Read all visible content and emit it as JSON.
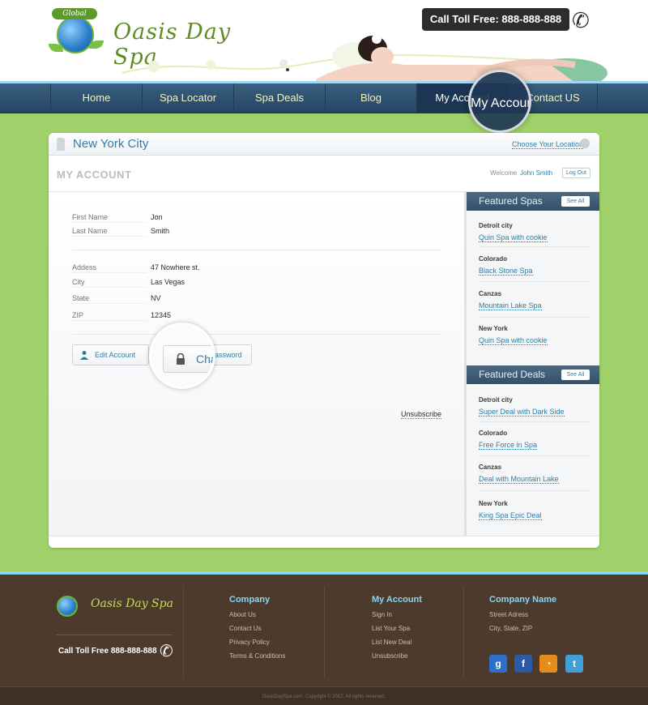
{
  "brand": {
    "name": "Oasis Day Spa",
    "badge": "Global"
  },
  "header": {
    "toll_label": "Call Toll Free: 888-888-888"
  },
  "nav": {
    "items": [
      {
        "label": "Home"
      },
      {
        "label": "Spa Locator"
      },
      {
        "label": "Spa Deals"
      },
      {
        "label": "Blog"
      },
      {
        "label": "My Account"
      },
      {
        "label": "Contact US"
      }
    ],
    "magnifier_text": "My Account"
  },
  "city_bar": {
    "city": "New York City",
    "choose": "Choose Your Location"
  },
  "account": {
    "title": "MY ACCOUNT",
    "welcome": "Welcome",
    "user": "John Smith",
    "logout": "Log Out",
    "fields": {
      "first_name": {
        "label": "First Name",
        "value": "Jon"
      },
      "last_name": {
        "label": "Last Name",
        "value": "Smith"
      },
      "address": {
        "label": "Addess",
        "value": "47 Nowhere st."
      },
      "city": {
        "label": "City",
        "value": "Las Vegas"
      },
      "state": {
        "label": "State",
        "value": "NV"
      },
      "zip": {
        "label": "ZIP",
        "value": "12345"
      }
    },
    "edit_button": "Edit Account",
    "change_password_partial": "assword",
    "change_password_zoom": "Cha",
    "unsubscribe": "Unsubscribe"
  },
  "featured_spas": {
    "title": "Featured Spas",
    "see_all": "See All",
    "items": [
      {
        "location": "Detroit city",
        "name": "Quin Spa with cookie"
      },
      {
        "location": "Colorado",
        "name": "Black Stone Spa"
      },
      {
        "location": "Canzas",
        "name": "Mountain Lake Spa"
      },
      {
        "location": "New York",
        "name": "Quin Spa with cookie"
      }
    ]
  },
  "featured_deals": {
    "title": "Featured Deals",
    "see_all": "See All",
    "items": [
      {
        "location": "Detroit city",
        "name": "Super Deal with Dark Side"
      },
      {
        "location": "Colorado",
        "name": "Free Force in Spa"
      },
      {
        "location": "Canzas",
        "name": "Deal with Mountain Lake"
      },
      {
        "location": "New York",
        "name": "King Spa Epic Deal"
      }
    ]
  },
  "footer": {
    "brand": "Oasis Day Spa",
    "toll": "Call Toll Free 888-888-888",
    "company": {
      "heading": "Company",
      "links": [
        "About Us",
        "Contact Us",
        "Privacy Policy",
        "Terms & Conditions"
      ]
    },
    "my_account": {
      "heading": "My Account",
      "links": [
        "Sign In",
        "List Your Spa",
        "List New Deal",
        "Unsubscribe"
      ]
    },
    "company_name": {
      "heading": "Company Name",
      "lines": [
        "Street Adress",
        "City, State, ZIP"
      ]
    },
    "social": [
      {
        "icon": "google-icon",
        "glyph": "g",
        "color": "#2b6fc9"
      },
      {
        "icon": "facebook-icon",
        "glyph": "f",
        "color": "#2d5aa5"
      },
      {
        "icon": "rss-icon",
        "glyph": "◔",
        "color": "#e58b1c"
      },
      {
        "icon": "twitter-icon",
        "glyph": "t",
        "color": "#3f9fd6"
      }
    ],
    "copyright": "OasisDaySpa.com. Copyright © 2012. All rights reserved."
  },
  "colors": {
    "accent": "#2f7ea5",
    "nav": "#2f4f6d",
    "page_bg": "#9fd06a",
    "footer_bg": "#4c3b2d"
  }
}
